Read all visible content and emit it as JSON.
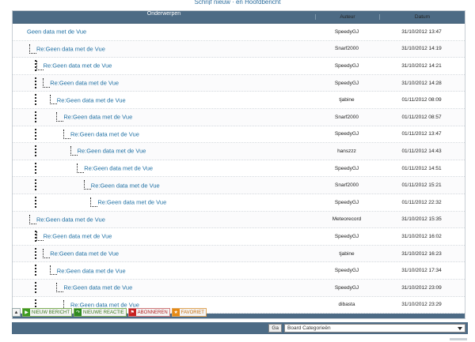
{
  "page": {
    "top_link": "Schrijf nieuw · en Hoofdbericht"
  },
  "table": {
    "headers": {
      "subject": "Onderwerpen",
      "author": "Auteur",
      "date": "Datum"
    },
    "rows": [
      {
        "subject": "Geen data met de Vue",
        "author": "SpeedyGJ",
        "date": "31/10/2012 13:47",
        "depth": 0
      },
      {
        "subject": "Re:Geen data met de Vue",
        "author": "Snarf2000",
        "date": "31/10/2012 14:19",
        "depth": 1
      },
      {
        "subject": "Re:Geen data met de Vue",
        "author": "SpeedyGJ",
        "date": "31/10/2012 14:21",
        "depth": 2
      },
      {
        "subject": "Re:Geen data met de Vue",
        "author": "SpeedyGJ",
        "date": "31/10/2012 14:28",
        "depth": 3
      },
      {
        "subject": "Re:Geen data met de Vue",
        "author": "tjabine",
        "date": "01/11/2012 08:09",
        "depth": 4
      },
      {
        "subject": "Re:Geen data met de Vue",
        "author": "Snarf2000",
        "date": "01/11/2012 08:57",
        "depth": 5
      },
      {
        "subject": "Re:Geen data met de Vue",
        "author": "SpeedyGJ",
        "date": "01/11/2012 13:47",
        "depth": 6
      },
      {
        "subject": "Re:Geen data met de Vue",
        "author": "hanszzz",
        "date": "01/11/2012 14:43",
        "depth": 7
      },
      {
        "subject": "Re:Geen data met de Vue",
        "author": "SpeedyGJ",
        "date": "01/11/2012 14:51",
        "depth": 8
      },
      {
        "subject": "Re:Geen data met de Vue",
        "author": "Snarf2000",
        "date": "01/11/2012 15:21",
        "depth": 9
      },
      {
        "subject": "Re:Geen data met de Vue",
        "author": "SpeedyGJ",
        "date": "01/11/2012 22:32",
        "depth": 10
      },
      {
        "subject": "Re:Geen data met de Vue",
        "author": "Meteorecord",
        "date": "31/10/2012 15:35",
        "depth": 1
      },
      {
        "subject": "Re:Geen data met de Vue",
        "author": "SpeedyGJ",
        "date": "31/10/2012 16:02",
        "depth": 2
      },
      {
        "subject": "Re:Geen data met de Vue",
        "author": "tjabine",
        "date": "31/10/2012 16:23",
        "depth": 3
      },
      {
        "subject": "Re:Geen data met de Vue",
        "author": "SpeedyGJ",
        "date": "31/10/2012 17:34",
        "depth": 4
      },
      {
        "subject": "Re:Geen data met de Vue",
        "author": "SpeedyGJ",
        "date": "31/10/2012 23:09",
        "depth": 5
      },
      {
        "subject": "Re:Geen data met de Vue",
        "author": "dibasta",
        "date": "31/10/2012 23:29",
        "depth": 6
      }
    ]
  },
  "actions": {
    "up_icon": "arrow-up-icon",
    "new_topic": "NIEUW BERICHT",
    "new_topic_icon": "play-icon",
    "new_reply": "NIEUWE REACTIE",
    "new_reply_icon": "reply-icon",
    "subscribe": "ABONNEREN",
    "subscribe_icon": "flag-icon",
    "favorite": "FAVORIET",
    "favorite_icon": "star-icon"
  },
  "bottom": {
    "go_label": "Ga",
    "category_select": "Board Categorieën"
  },
  "colors": {
    "header_bar": "#4d6b85",
    "link": "#1e6fa3",
    "green": "#3d9a1f",
    "red": "#c82020",
    "orange": "#e68a14"
  }
}
